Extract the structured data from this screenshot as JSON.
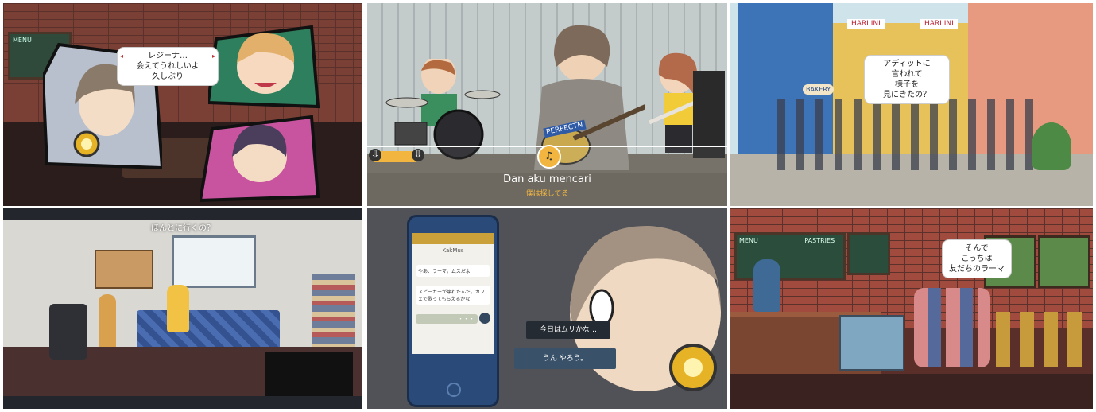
{
  "panel1": {
    "speech": [
      "レジーナ…",
      "会えてうれしいよ",
      "久しぶり"
    ],
    "bubble_arrow_left": "◂",
    "bubble_arrow_right": "▸",
    "chalkboard": "MENU"
  },
  "panel2": {
    "lyric_main": "Dan aku mencari",
    "lyric_translation": "僕は探してる",
    "shirt_text": "PERFECTN",
    "note_icon": "♫",
    "lane_arrow": "⇩",
    "colors": {
      "accent": "#f2b640"
    }
  },
  "panel3": {
    "speech": [
      "アディットに",
      "言われて",
      "様子を",
      "見にきたの？"
    ],
    "sign_left": "HARI INI",
    "sign_right": "HARI INI",
    "shop_sign": "BAKERY"
  },
  "panel4": {
    "subtitle": "ほんとに行くの？"
  },
  "panel5": {
    "app_name": "KakMus",
    "messages": [
      "やあ、ラーマ。ムスだよ",
      "スピーカーが壊れたんだ。カフェで歌ってもらえるかな"
    ],
    "typing_placeholder": "・・・",
    "dialog_prompt": "今日はムリかな…",
    "dialog_choice": "うん やろう。"
  },
  "panel6": {
    "speech": [
      "そんで",
      "こっちは",
      "友だちのラーマ"
    ],
    "chalkboard_title": "MENU",
    "chalkboard_title2": "PASTRIES"
  }
}
